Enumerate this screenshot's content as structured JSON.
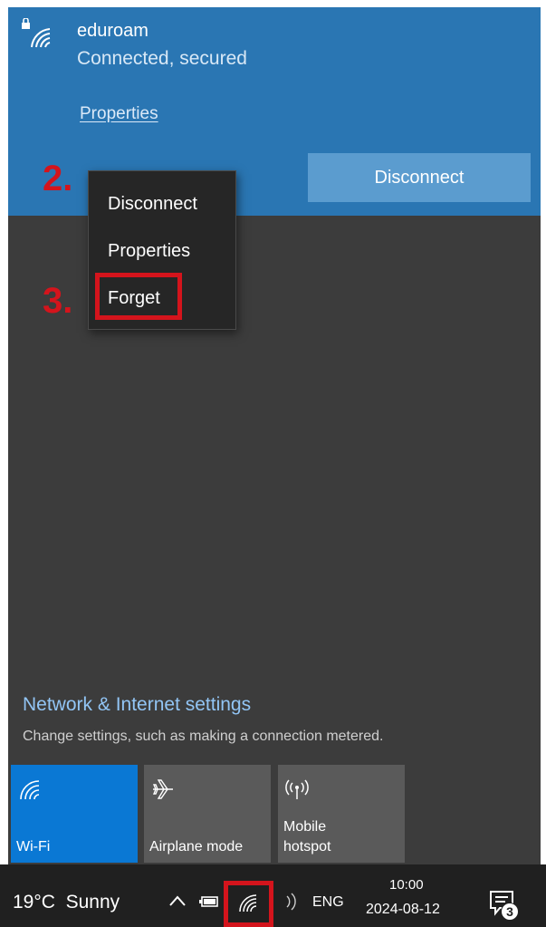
{
  "network": {
    "name": "eduroam",
    "status": "Connected, secured",
    "properties_link": "Properties",
    "disconnect_button": "Disconnect"
  },
  "annotations": {
    "step2": "2.",
    "step3": "3."
  },
  "context_menu": {
    "items": [
      "Disconnect",
      "Properties",
      "Forget"
    ],
    "highlighted": "Forget"
  },
  "settings": {
    "title": "Network & Internet settings",
    "description": "Change settings, such as making a connection metered."
  },
  "quick_actions": [
    {
      "label": "Wi-Fi",
      "active": true,
      "icon": "wifi-icon"
    },
    {
      "label": "Airplane mode",
      "active": false,
      "icon": "airplane-icon"
    },
    {
      "label": "Mobile hotspot",
      "active": false,
      "icon": "hotspot-icon"
    }
  ],
  "taskbar": {
    "weather": "19°C  Sunny",
    "language": "ENG",
    "time": "10:00",
    "date": "2024-08-12",
    "notification_count": "3"
  },
  "colors": {
    "accent": "#0a78d4",
    "network_card": "#2a76b3",
    "highlight": "#d4141c",
    "flyout_bg": "#3c3c3c"
  }
}
